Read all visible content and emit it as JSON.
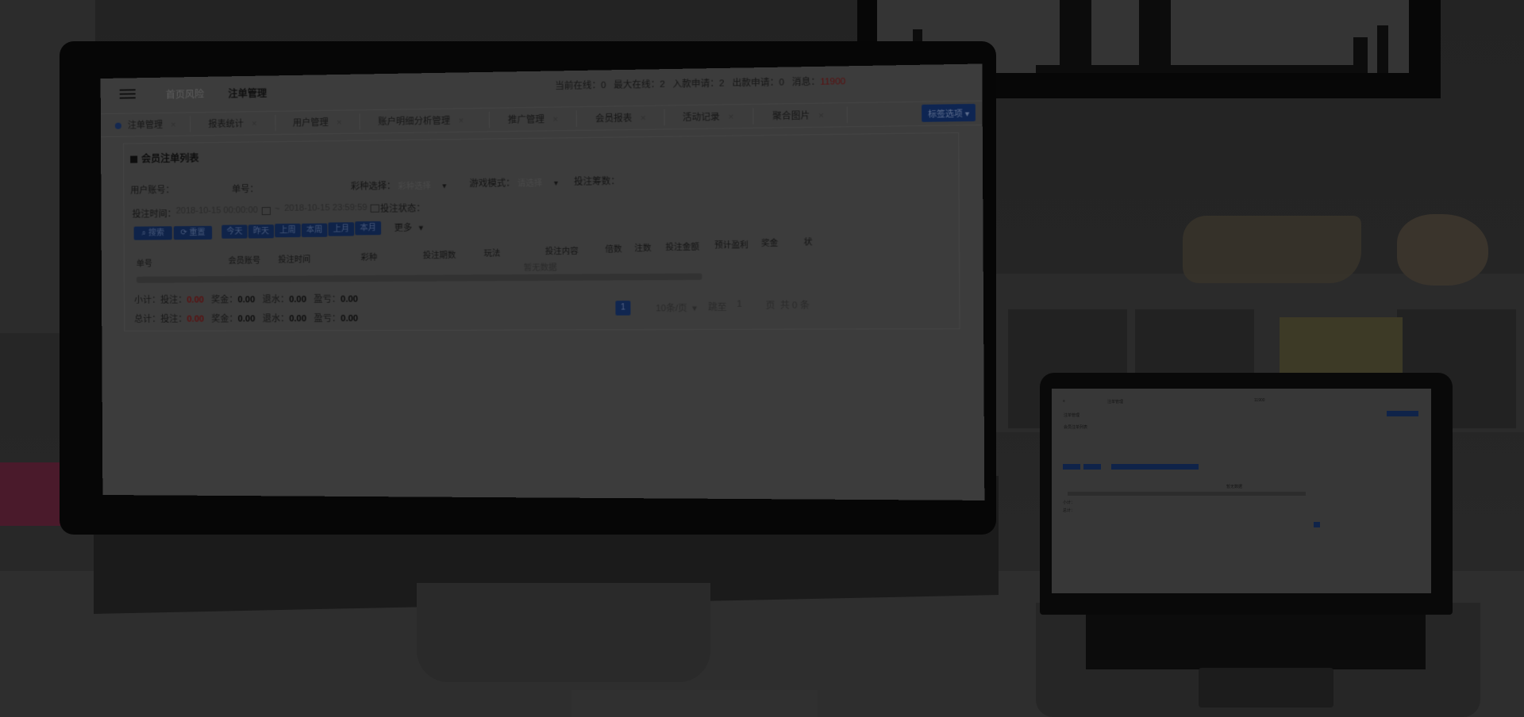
{
  "app": {
    "breadcrumb": {
      "parent": "首页风险",
      "current": "注单管理"
    },
    "stats": {
      "online_label": "当前在线：",
      "online_value": "0",
      "max_label": "最大在线：",
      "max_value": "2",
      "deposit_label": "入款申请：",
      "deposit_value": "2",
      "withdraw_label": "出款申请：",
      "withdraw_value": "0",
      "msg_label": "消息：",
      "msg_value": "11900"
    },
    "tabs": [
      "注单管理",
      "报表统计",
      "用户管理",
      "账户明细分析管理",
      "推广管理",
      "会员报表",
      "活动记录",
      "聚合图片"
    ],
    "tab_close": "×",
    "close_all": "标签选项 ▾"
  },
  "panel": {
    "title": "会员注单列表",
    "filters": {
      "account_label": "用户账号：",
      "order_label": "单号：",
      "lottery_label": "彩种选择：",
      "lottery_value": "彩种选择",
      "mode_label": "游戏模式：",
      "mode_value": "请选择",
      "amount_label": "投注筹数：",
      "time_label": "投注时间：",
      "time_start": "2018-10-15 00:00:00",
      "time_sep": "~",
      "time_end": "2018-10-15 23:59:59",
      "status_label": "投注状态："
    },
    "buttons": {
      "search": "搜索",
      "reset": "重置",
      "quick": [
        "今天",
        "昨天",
        "上周",
        "本周",
        "上月",
        "本月"
      ],
      "more": "更多"
    },
    "table_headers": [
      "单号",
      "会员账号",
      "投注时间",
      "彩种",
      "投注期数",
      "玩法",
      "投注内容",
      "倍数",
      "注数",
      "投注金额",
      "预计盈利",
      "奖金",
      "状"
    ],
    "empty_text": "暂无数据",
    "subtotal": {
      "label": "小计：",
      "bet_label": "投注：",
      "bet_value": "0.00",
      "bonus_label": "奖金：",
      "bonus_value": "0.00",
      "rebate_label": "退水：",
      "rebate_value": "0.00",
      "profit_label": "盈亏：",
      "profit_value": "0.00"
    },
    "total": {
      "label": "总计：",
      "bet_label": "投注：",
      "bet_value": "0.00",
      "bonus_label": "奖金：",
      "bonus_value": "0.00",
      "rebate_label": "退水：",
      "rebate_value": "0.00",
      "profit_label": "盈亏：",
      "profit_value": "0.00"
    },
    "pager": {
      "page": "1",
      "per_page": "10条/页",
      "goto_label": "跳至",
      "goto_value": "1",
      "page_suffix": "页",
      "total": "共 0 条"
    }
  }
}
